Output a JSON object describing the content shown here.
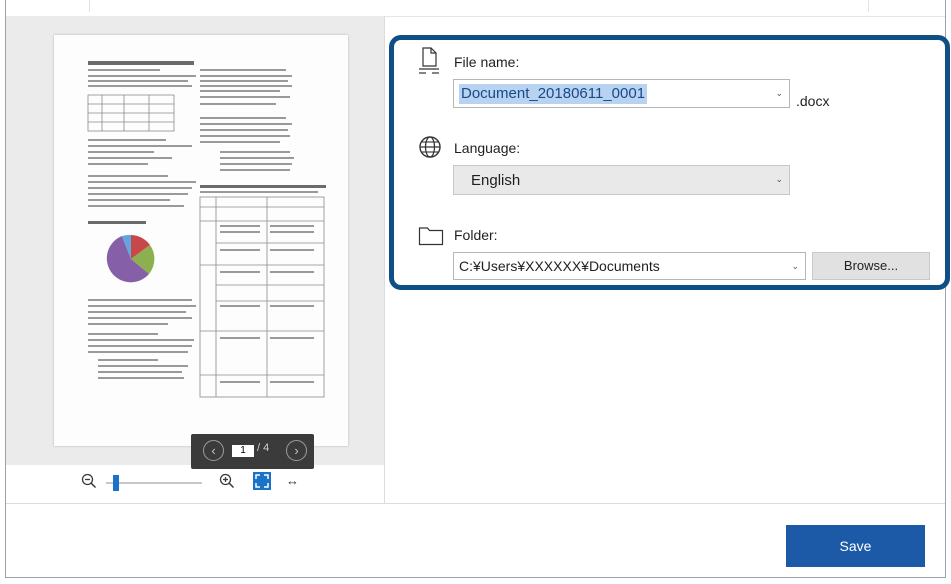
{
  "preview": {
    "page_current": "1",
    "page_separator": "/ 4",
    "prev_symbol": "‹",
    "next_symbol": "›"
  },
  "zoom": {
    "level_fraction": 0.08,
    "fit_width_symbol": "↔"
  },
  "settings": {
    "file_name": {
      "label": "File name:",
      "value": "Document_20180611_0001",
      "extension": ".docx",
      "icon": "document-icon"
    },
    "language": {
      "label": "Language:",
      "value": "English",
      "icon": "globe-icon"
    },
    "folder": {
      "label": "Folder:",
      "value": "C:¥Users¥XXXXXX¥Documents",
      "browse_label": "Browse...",
      "icon": "folder-icon"
    },
    "highlight_color": "#0f4f86"
  },
  "footer": {
    "save_label": "Save",
    "save_color": "#1c5aa8"
  }
}
